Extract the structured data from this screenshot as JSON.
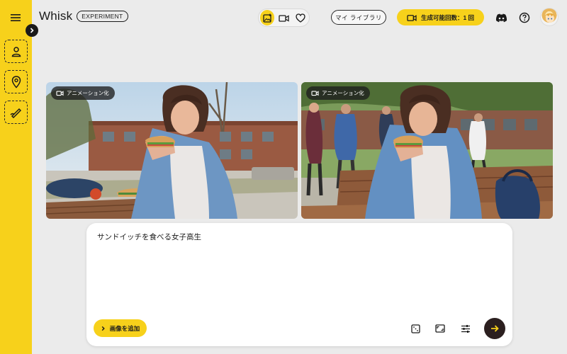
{
  "header": {
    "logo_text": "Whisk",
    "badge": "EXPERIMENT",
    "library_label": "マイ ライブラリ",
    "gen_count_label": "生成可能回数：1 回"
  },
  "images": [
    {
      "animate_label": "アニメーション化"
    },
    {
      "animate_label": "アニメーション化"
    }
  ],
  "prompt": {
    "text": "サンドイッチを食べる女子高生",
    "add_image_label": "画像を追加"
  },
  "colors": {
    "accent": "#f7d11b",
    "submit": "#2b1f1f"
  },
  "icons": [
    "menu-icon",
    "person-icon",
    "location-pin-icon",
    "brush-icon",
    "image-plus-icon",
    "video-icon",
    "heart-icon",
    "discord-icon",
    "help-icon",
    "dice-icon",
    "aspect-ratio-icon",
    "sliders-icon",
    "arrow-right-icon"
  ]
}
